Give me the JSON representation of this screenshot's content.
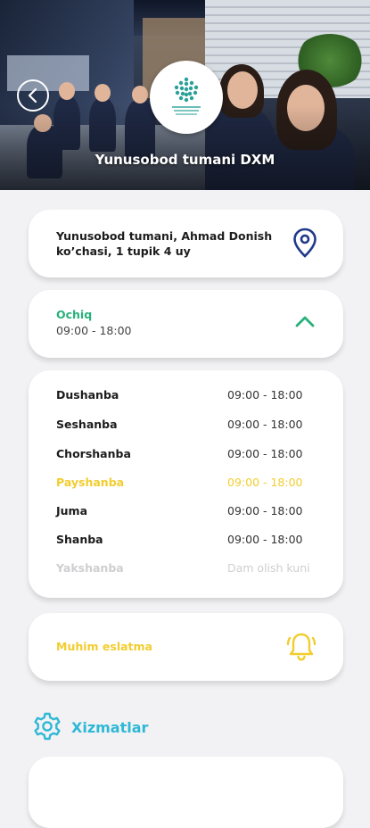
{
  "header": {
    "title": "Yunusobod tumani DXM",
    "back_icon": "arrow-left-icon",
    "logo_icon": "dxm-dots-logo"
  },
  "address": {
    "text": "Yunusobod tumani,  Ahmad Donish ko’chasi, 1 tupik 4 uy",
    "icon": "location-pin-icon"
  },
  "status": {
    "label": "Ochiq",
    "hours": "09:00 - 18:00",
    "icon": "chevron-up-icon"
  },
  "schedule": [
    {
      "day": "Dushanba",
      "time": "09:00 - 18:00",
      "state": "normal"
    },
    {
      "day": "Seshanba",
      "time": "09:00 - 18:00",
      "state": "normal"
    },
    {
      "day": "Chorshanba",
      "time": "09:00 - 18:00",
      "state": "normal"
    },
    {
      "day": "Payshanba",
      "time": "09:00 - 18:00",
      "state": "today"
    },
    {
      "day": "Juma",
      "time": "09:00 - 18:00",
      "state": "normal"
    },
    {
      "day": "Shanba",
      "time": "09:00 - 18:00",
      "state": "normal"
    },
    {
      "day": "Yakshanba",
      "time": "Dam olish kuni",
      "state": "off"
    }
  ],
  "reminder": {
    "label": "Muhim eslatma",
    "icon": "bell-icon"
  },
  "services": {
    "label": "Xizmatlar",
    "icon": "gear-icon"
  },
  "colors": {
    "open": "#27b17a",
    "today": "#f2cd2f",
    "accent": "#2fb8d6",
    "pin": "#1f3a8a",
    "off": "#cfcfd2"
  }
}
